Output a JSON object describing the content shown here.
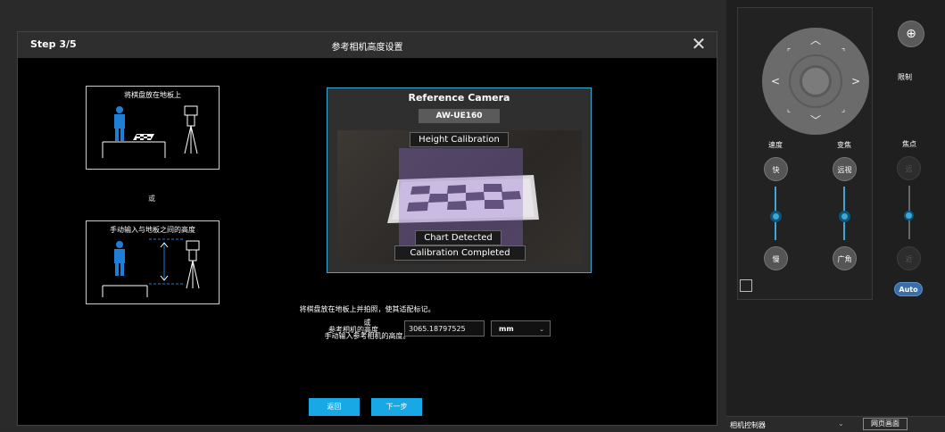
{
  "dialog": {
    "step": "Step 3/5",
    "title": "参考相机高度设置",
    "close_symbol": "✕"
  },
  "panels": {
    "floor_title": "将棋盘放在地板上",
    "or_1": "或",
    "manual_title": "手动输入与地板之间的高度"
  },
  "reference": {
    "title": "Reference Camera",
    "model": "AW-UE160",
    "tag_height": "Height Calibration",
    "tag_detected": "Chart Detected",
    "tag_completed": "Calibration Completed"
  },
  "instructions": {
    "line1": "将棋盘放在地板上并拍照，使其适配标记。",
    "line2": "或",
    "line3": "手动输入参考相机的高度。"
  },
  "height": {
    "label": "参考相机的高度",
    "value": "3065.18797525",
    "unit": "mm"
  },
  "buttons": {
    "back": "返回",
    "next": "下一步"
  },
  "controller": {
    "limit_label": "限制",
    "speed_label": "速度",
    "zoom_label": "变焦",
    "focus_label": "焦点",
    "speed_fast": "快",
    "speed_slow": "慢",
    "zoom_tele": "远视",
    "zoom_wide": "广角",
    "focus_far": "远",
    "focus_near": "近",
    "auto": "Auto",
    "speed_level": 0.55,
    "zoom_level": 0.55,
    "focus_level": 0.55
  },
  "bottom": {
    "controller_label": "相机控制器",
    "web_button": "网页画面"
  },
  "colors": {
    "accent": "#19a8e6",
    "frame": "#3da7d6",
    "figure_blue": "#1e7fd6"
  }
}
